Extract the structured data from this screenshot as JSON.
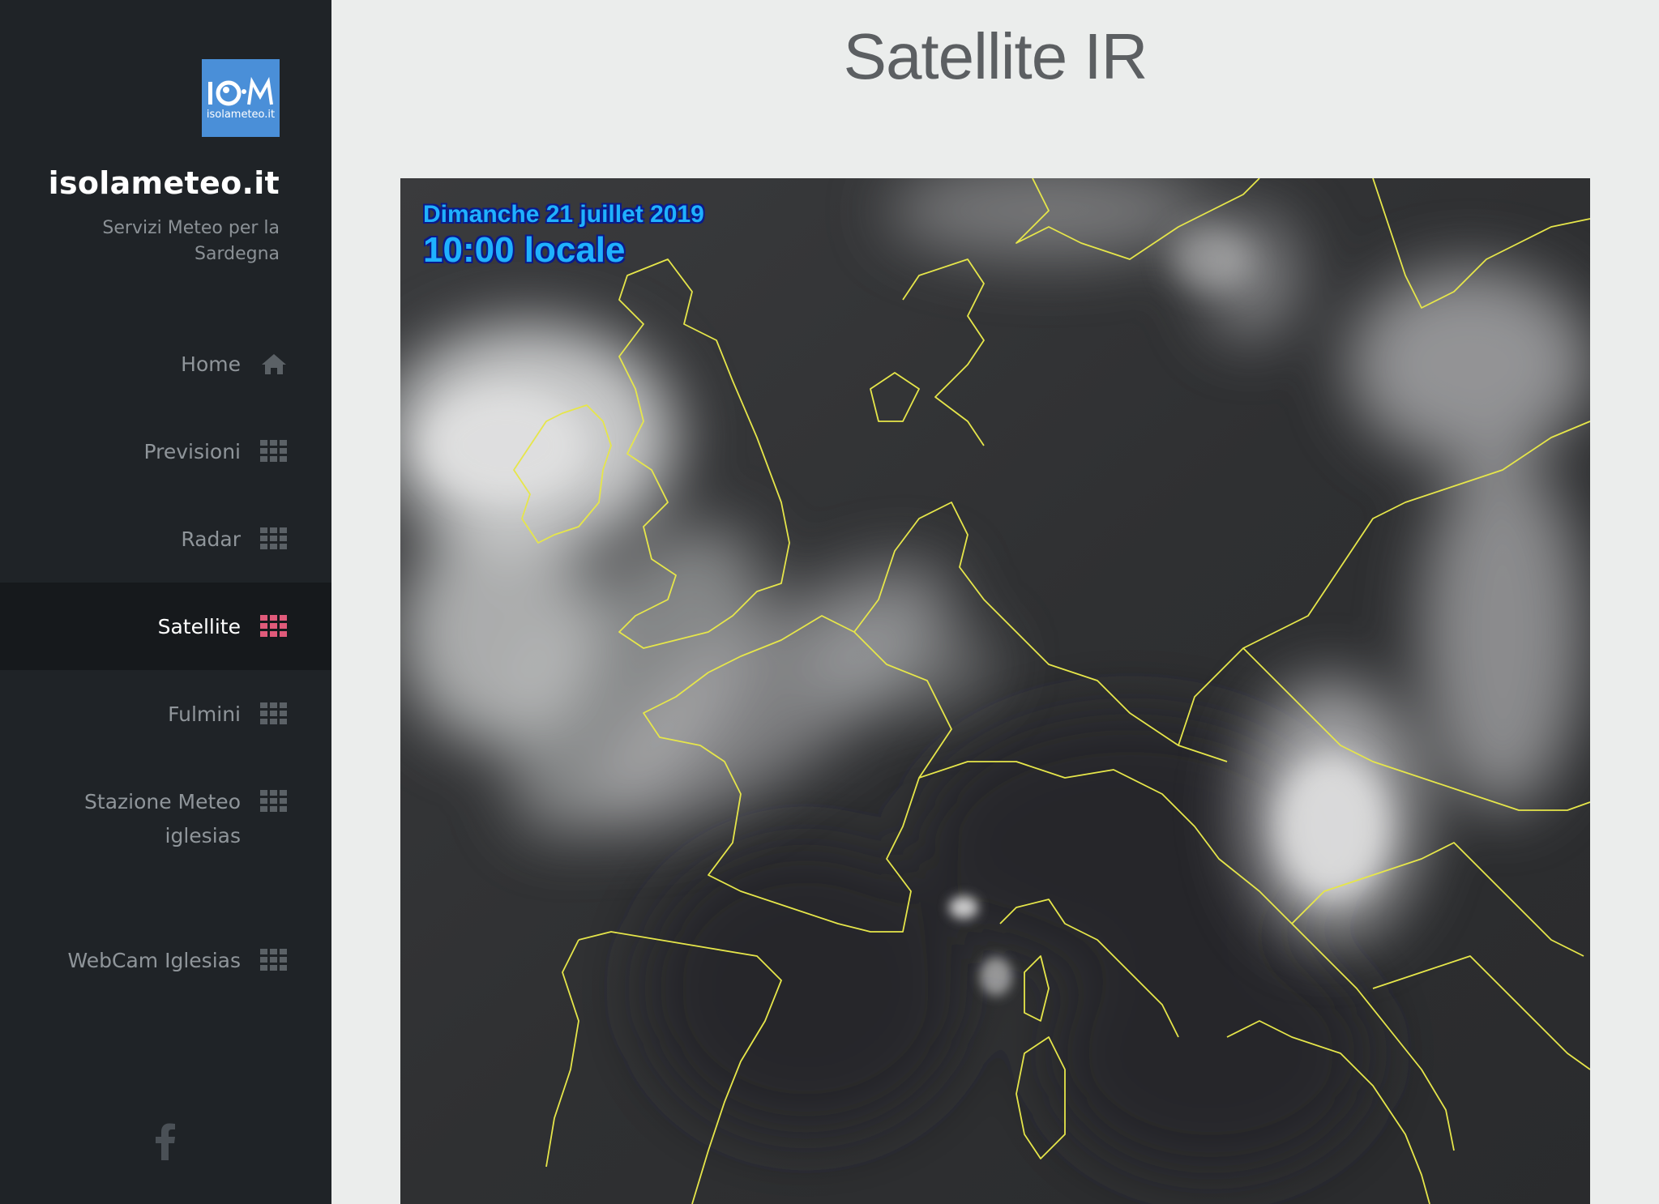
{
  "sidebar": {
    "logo_text": "isolameteo.it",
    "site_title": "isolameteo.it",
    "tagline": "Servizi Meteo per la Sardegna",
    "nav": [
      {
        "label": "Home",
        "icon": "home-icon"
      },
      {
        "label": "Previsioni",
        "icon": "grid-icon"
      },
      {
        "label": "Radar",
        "icon": "grid-icon"
      },
      {
        "label": "Satellite",
        "icon": "grid-icon",
        "active": true
      },
      {
        "label": "Fulmini",
        "icon": "grid-icon"
      },
      {
        "label": "Stazione Meteo",
        "icon": "grid-icon"
      },
      {
        "label": "iglesias"
      },
      {
        "label": "WebCam Iglesias",
        "icon": "grid-icon"
      }
    ],
    "social_icon": "facebook-icon"
  },
  "main": {
    "title": "Satellite IR",
    "satellite": {
      "date": "Dimanche 21 juillet 2019",
      "time": "10:00 locale"
    }
  },
  "colors": {
    "sidebar_bg": "#1f2327",
    "active_bg": "#16191c",
    "accent": "#e05a7a",
    "logo_bg": "#4a8fd8",
    "coastline": "#e6e64a",
    "overlay_text": "#1fb1ff"
  }
}
